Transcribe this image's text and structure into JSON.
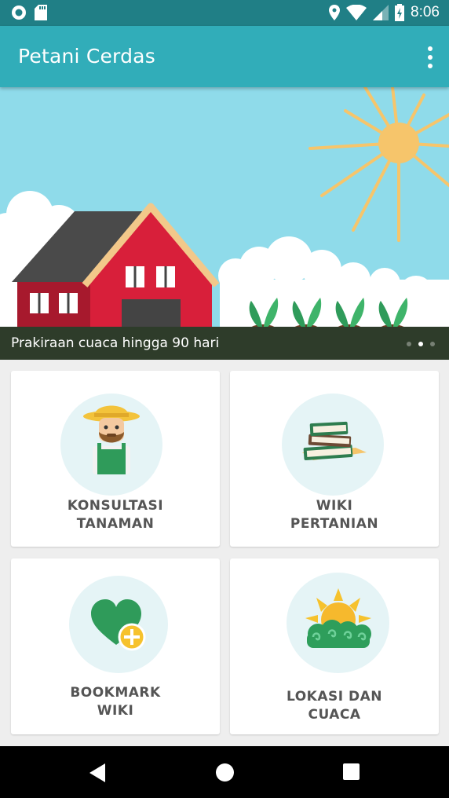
{
  "status_bar": {
    "time": "8:06"
  },
  "app_bar": {
    "title": "Petani Cerdas"
  },
  "banner": {
    "caption": "Prakiraan cuaca hingga 90 hari",
    "slide_count": 3,
    "active_slide": 2
  },
  "menu": [
    {
      "line1": "KONSULTASI",
      "line2": "TANAMAN",
      "icon": "farmer-icon"
    },
    {
      "line1": "WIKI",
      "line2": "PERTANIAN",
      "icon": "books-icon"
    },
    {
      "line1": "BOOKMARK",
      "line2": "WIKI",
      "icon": "heart-plus-icon"
    },
    {
      "line1": "LOKASI DAN",
      "line2": "CUACA",
      "icon": "sun-cloud-icon"
    }
  ],
  "colors": {
    "primary": "#31adb9",
    "primary_dark": "#207f86",
    "sky": "#8fdbea",
    "barn": "#d81f3a"
  }
}
